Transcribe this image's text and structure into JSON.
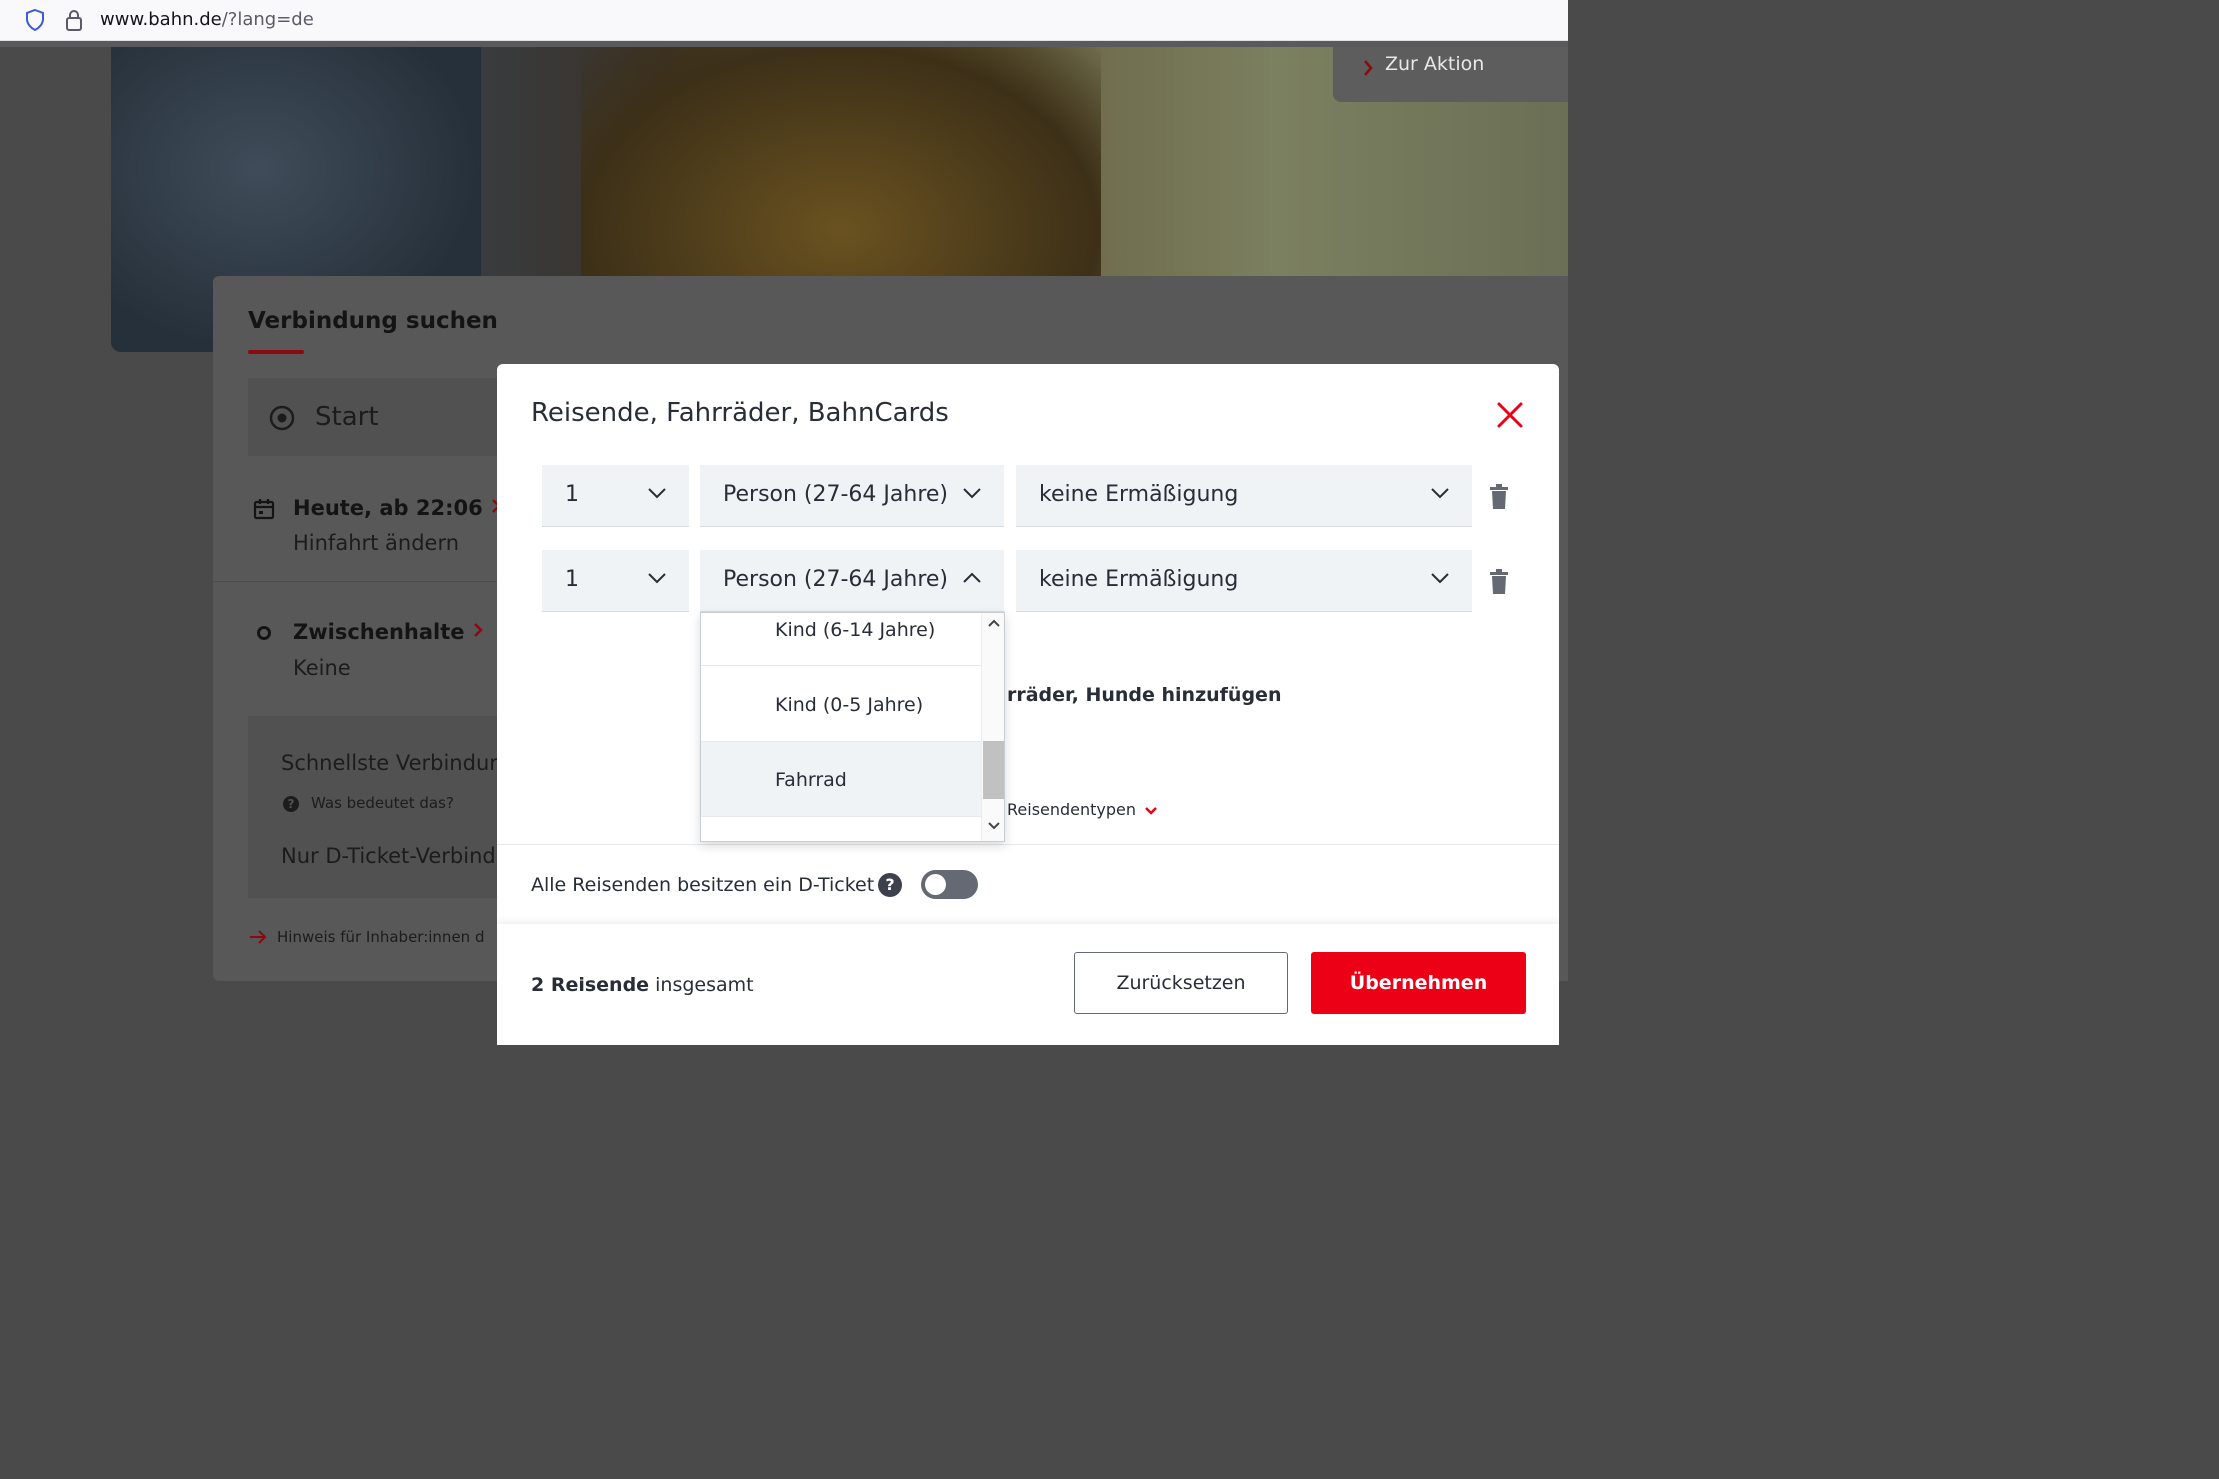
{
  "browser": {
    "url_host": "www.bahn.de",
    "url_path": "/?lang=de"
  },
  "promo": {
    "action_label": "Zur Aktion"
  },
  "search_card": {
    "title": "Verbindung suchen",
    "start_placeholder": "Start",
    "date_label": "Heute, ab 22:06",
    "date_sub": "Hinfahrt ändern",
    "stops_label": "Zwischenhalte",
    "stops_value": "Keine",
    "fastest_label": "Schnellste Verbindur",
    "help_text": "Was bedeutet das?",
    "dticket_only_label": "Nur D-Ticket-Verbind",
    "hint_text": "Hinweis für Inhaber:innen d"
  },
  "modal": {
    "title": "Reisende, Fahrräder, BahnCards",
    "travelers": [
      {
        "count": "1",
        "type": "Person (27-64 Jahre)",
        "discount": "keine Ermäßigung",
        "type_open": false
      },
      {
        "count": "1",
        "type": "Person (27-64 Jahre)",
        "discount": "keine Ermäßigung",
        "type_open": true
      }
    ],
    "add_more_text": "rräder, Hunde hinzufügen",
    "types_link": "Reisendentypen",
    "dticket_toggle_label": "Alle Reisenden besitzen ein D-Ticket",
    "dticket_toggle_on": false,
    "total_count": "2 Reisende",
    "total_suffix": "insgesamt",
    "reset_label": "Zurücksetzen",
    "apply_label": "Übernehmen"
  },
  "type_dropdown": {
    "options": [
      "Kind (6-14 Jahre)",
      "Kind (0-5 Jahre)",
      "Fahrrad"
    ],
    "highlighted": "Fahrrad"
  },
  "colors": {
    "brand_red": "#ec0016",
    "text": "#282d37",
    "field_bg": "#f0f3f5"
  }
}
